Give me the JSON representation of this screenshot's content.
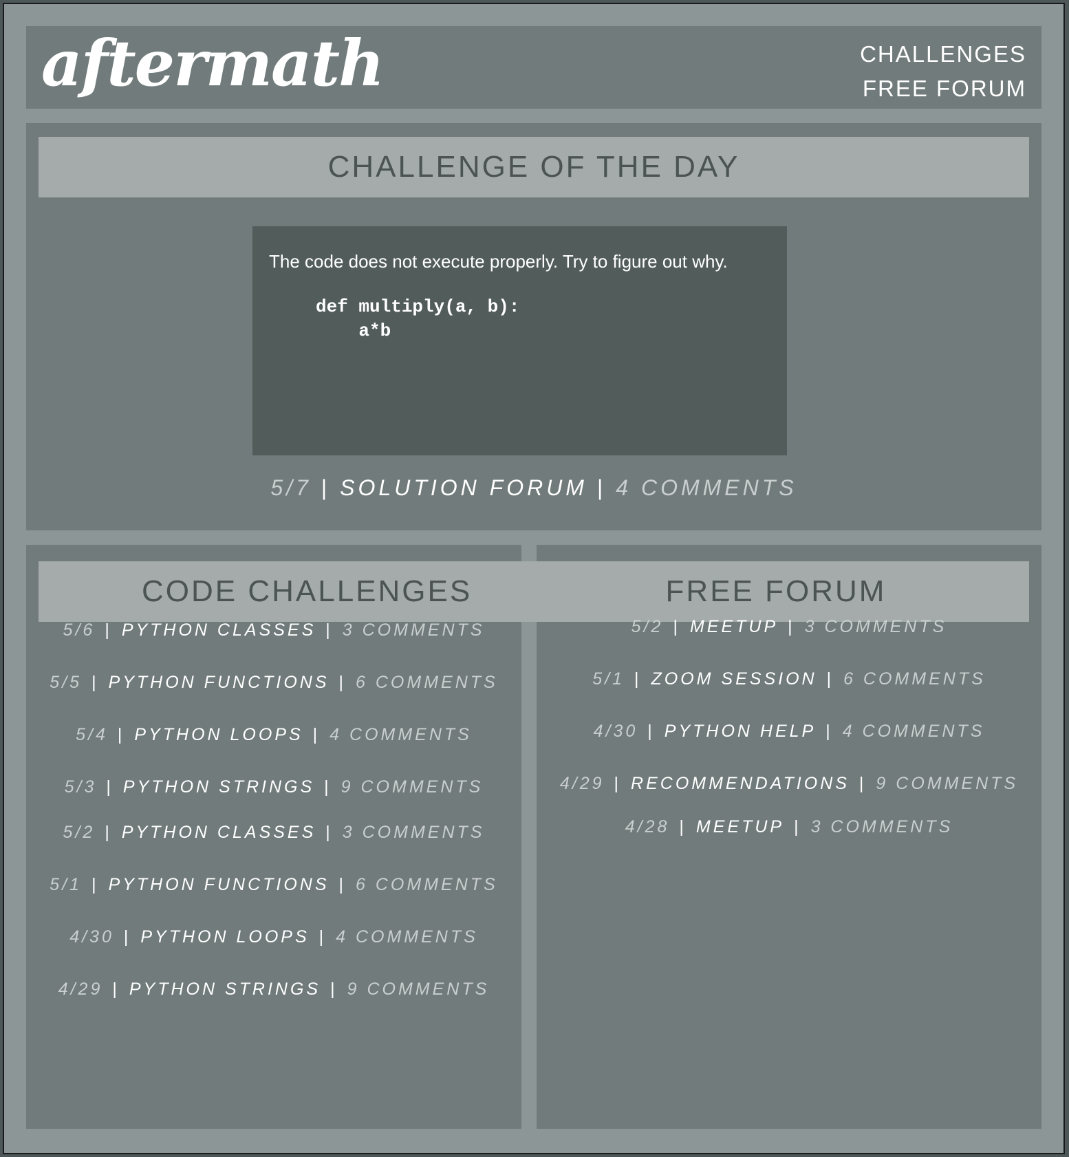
{
  "header": {
    "logo": "aftermath",
    "nav": [
      "CHALLENGES",
      "FREE FORUM"
    ]
  },
  "challenge_of_day": {
    "heading": "CHALLENGE OF THE DAY",
    "prompt": "The code does not execute properly. Try to figure out why.",
    "code": "def multiply(a, b):\n    a*b",
    "date": "5/7",
    "link": "SOLUTION FORUM",
    "comments": "4 COMMENTS",
    "separator": "|"
  },
  "code_challenges": {
    "heading": "CODE CHALLENGES",
    "items": [
      {
        "date": "5/6",
        "title": "PYTHON CLASSES",
        "comments": "3 COMMENTS"
      },
      {
        "date": "5/5",
        "title": "PYTHON FUNCTIONS",
        "comments": "6 COMMENTS"
      },
      {
        "date": "5/4",
        "title": "PYTHON LOOPS",
        "comments": "4 COMMENTS"
      },
      {
        "date": "5/3",
        "title": "PYTHON STRINGS",
        "comments": "9 COMMENTS"
      },
      {
        "date": "5/2",
        "title": "PYTHON CLASSES",
        "comments": "3 COMMENTS"
      },
      {
        "date": "5/1",
        "title": "PYTHON FUNCTIONS",
        "comments": "6 COMMENTS"
      },
      {
        "date": "4/30",
        "title": "PYTHON LOOPS",
        "comments": "4 COMMENTS"
      },
      {
        "date": "4/29",
        "title": "PYTHON STRINGS",
        "comments": "9 COMMENTS"
      }
    ]
  },
  "free_forum": {
    "heading": "FREE FORUM",
    "items": [
      {
        "date": "5/2",
        "title": "MEETUP",
        "comments": "3 COMMENTS"
      },
      {
        "date": "5/1",
        "title": "ZOOM SESSION",
        "comments": "6 COMMENTS"
      },
      {
        "date": "4/30",
        "title": "PYTHON HELP",
        "comments": "4 COMMENTS"
      },
      {
        "date": "4/29",
        "title": "RECOMMENDATIONS",
        "comments": "9 COMMENTS"
      },
      {
        "date": "4/28",
        "title": "MEETUP",
        "comments": "3 COMMENTS"
      }
    ]
  }
}
